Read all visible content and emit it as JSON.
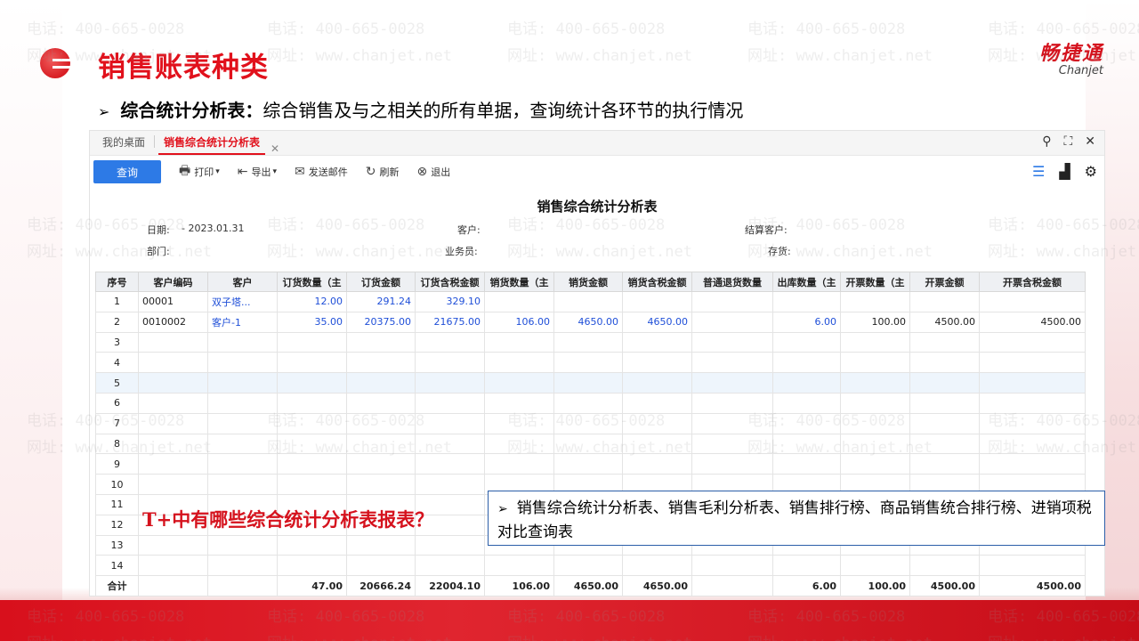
{
  "watermark": {
    "phone": "电话: 400-665-0028",
    "site": "网址: www.chanjet.net"
  },
  "header": {
    "title": "销售账表种类",
    "brand_cn": "畅捷通",
    "brand_en": "Chanjet"
  },
  "subtitle": {
    "bullet": "➢",
    "bold": "综合统计分析表：",
    "text": "综合销售及与之相关的所有单据，查询统计各环节的执行情况"
  },
  "tabs": [
    {
      "label": "我的桌面"
    },
    {
      "label": "销售综合统计分析表"
    }
  ],
  "toolbar": {
    "query": "查询",
    "print": "打印",
    "export": "导出",
    "email": "发送邮件",
    "refresh": "刷新",
    "exit": "退出"
  },
  "report": {
    "title": "销售综合统计分析表",
    "date_label": "日期:",
    "date_value": "- 2023.01.31",
    "dept_label": "部门:",
    "customer_label": "客户:",
    "salesman_label": "业务员:",
    "settle_customer_label": "结算客户:",
    "stock_label": "存货:"
  },
  "table": {
    "headers": [
      "序号",
      "客户编码",
      "客户",
      "订货数量（主",
      "订货金额",
      "订货含税金额",
      "销货数量（主",
      "销货金额",
      "销货含税金额",
      "普通退货数量",
      "出库数量（主",
      "开票数量（主",
      "开票金额",
      "开票含税金额"
    ],
    "rows": [
      [
        "1",
        "00001",
        "双子塔...",
        "12.00",
        "291.24",
        "329.10",
        "",
        "",
        "",
        "",
        "",
        "",
        "",
        ""
      ],
      [
        "2",
        "0010002",
        "客户-1",
        "35.00",
        "20375.00",
        "21675.00",
        "106.00",
        "4650.00",
        "4650.00",
        "",
        "6.00",
        "100.00",
        "4500.00",
        "4500.00"
      ],
      [
        "3",
        "",
        "",
        "",
        "",
        "",
        "",
        "",
        "",
        "",
        "",
        "",
        "",
        ""
      ],
      [
        "4",
        "",
        "",
        "",
        "",
        "",
        "",
        "",
        "",
        "",
        "",
        "",
        "",
        ""
      ],
      [
        "5",
        "",
        "",
        "",
        "",
        "",
        "",
        "",
        "",
        "",
        "",
        "",
        "",
        ""
      ],
      [
        "6",
        "",
        "",
        "",
        "",
        "",
        "",
        "",
        "",
        "",
        "",
        "",
        "",
        ""
      ],
      [
        "7",
        "",
        "",
        "",
        "",
        "",
        "",
        "",
        "",
        "",
        "",
        "",
        "",
        ""
      ],
      [
        "8",
        "",
        "",
        "",
        "",
        "",
        "",
        "",
        "",
        "",
        "",
        "",
        "",
        ""
      ],
      [
        "9",
        "",
        "",
        "",
        "",
        "",
        "",
        "",
        "",
        "",
        "",
        "",
        "",
        ""
      ],
      [
        "10",
        "",
        "",
        "",
        "",
        "",
        "",
        "",
        "",
        "",
        "",
        "",
        "",
        ""
      ],
      [
        "11",
        "",
        "",
        "",
        "",
        "",
        "",
        "",
        "",
        "",
        "",
        "",
        "",
        ""
      ],
      [
        "12",
        "",
        "",
        "",
        "",
        "",
        "",
        "",
        "",
        "",
        "",
        "",
        "",
        ""
      ],
      [
        "13",
        "",
        "",
        "",
        "",
        "",
        "",
        "",
        "",
        "",
        "",
        "",
        "",
        ""
      ],
      [
        "14",
        "",
        "",
        "",
        "",
        "",
        "",
        "",
        "",
        "",
        "",
        "",
        "",
        ""
      ]
    ],
    "total": [
      "合计",
      "",
      "",
      "47.00",
      "20666.24",
      "22004.10",
      "106.00",
      "4650.00",
      "4650.00",
      "",
      "6.00",
      "100.00",
      "4500.00",
      "4500.00"
    ]
  },
  "question": "T+中有哪些综合统计分析表报表？",
  "callout": {
    "bullet": "➢",
    "text": "销售综合统计分析表、销售毛利分析表、销售排行榜、商品销售统合排行榜、进销项税对比查询表"
  },
  "colors": {
    "brand_red": "#e1111c",
    "primary_blue": "#2d7ae6",
    "link_blue": "#1f4fd8"
  }
}
